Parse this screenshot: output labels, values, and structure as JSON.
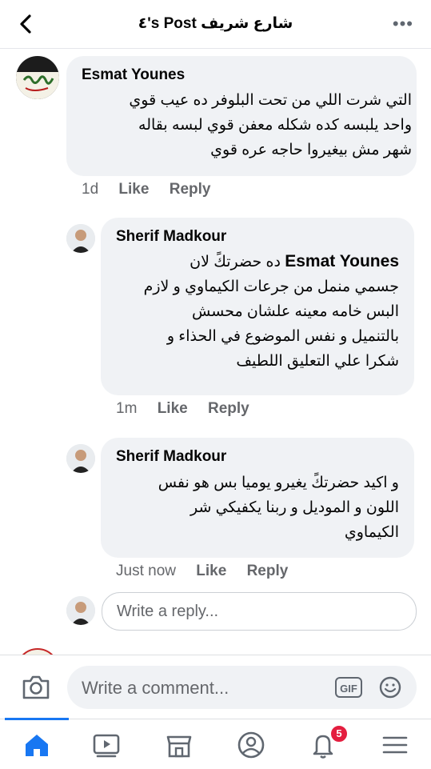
{
  "header": {
    "title": "٤'s Post شارع شريف",
    "back_icon": "chevron-left-icon",
    "more_icon": "ellipsis-icon"
  },
  "comments": [
    {
      "author": "Esmat Younes",
      "lines": [
        "التي شرت اللي من تحت البلوفر ده عيب قوي",
        "واحد يلبسه كده شكله معفن قوي لبسه بقاله",
        "شهر مش بيغيروا حاجه عره قوي"
      ],
      "time": "1d",
      "like": "Like",
      "reply": "Reply"
    },
    {
      "author": "Sherif Madkour",
      "mention": "Esmat Younes",
      "lines": [
        "ده حضرتكً لان",
        "جسمي منمل من جرعات الكيماوي و لازم",
        "البس خامه معينه علشان محسش",
        "بالتنميل و نفس الموضوع في الحذاء و",
        "شكرا علي التعليق اللطيف"
      ],
      "time": "1m",
      "like": "Like",
      "reply": "Reply"
    },
    {
      "author": "Sherif Madkour",
      "lines": [
        "و اكيد حضرتكً يغيرو يوميا بس هو نفس",
        "اللون و الموديل و ربنا يكفيكي شر",
        "الكيماوي"
      ],
      "time": "Just now",
      "like": "Like",
      "reply": "Reply"
    }
  ],
  "reply_input": {
    "placeholder": "Write a reply..."
  },
  "composer": {
    "placeholder": "Write a comment...",
    "camera_icon": "camera-icon",
    "gif_label": "GIF",
    "emoji_icon": "smiley-icon"
  },
  "tabbar": {
    "items": [
      "home-icon",
      "watch-icon",
      "marketplace-icon",
      "profile-icon",
      "notifications-icon",
      "menu-icon"
    ],
    "notifications_badge": "5",
    "accent": "#1877f2"
  }
}
